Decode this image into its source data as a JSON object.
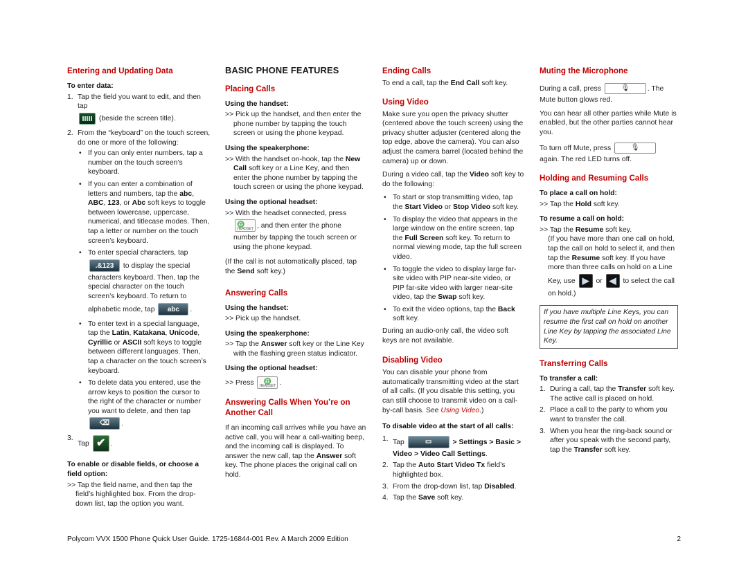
{
  "page_title": "BASIC PHONE FEATURES",
  "icons": {
    "keyboard": "keyboard-icon",
    "special_chars_label": ".&123",
    "abc_label": "abc",
    "delete_glyph": "⌫",
    "ok_glyph": "✔",
    "menu_glyph": "▭",
    "headset_glyph": "♎",
    "headset_label": "HEADSET",
    "mute_glyph": "🎙",
    "next_glyph": "▶",
    "prev_glyph": "◀"
  },
  "col1": {
    "heading": "Entering and Updating Data",
    "sub1": "To enter data:",
    "step1_a": "Tap the field you want to edit, and then tap",
    "step1_b": "(beside the screen title).",
    "step2": "From the “keyboard” on the touch screen, do one or more of the following:",
    "b1": "If you can only enter numbers, tap a number on the touch screen’s keyboard.",
    "b2_a": "If you can enter a combination of letters and numbers, tap the",
    "b2_abc": "abc",
    "b2_ABC": "ABC",
    "b2_123": "123",
    "b2_or": "or",
    "b2_Abc": "Abc",
    "b2_b": "soft keys to toggle between lowercase, uppercase, numerical, and titlecase modes. Then, tap a letter or number on the touch screen’s keyboard.",
    "b3_a": "To enter special characters, tap",
    "b3_b": "to display the special characters keyboard. Then, tap the special character on the touch screen’s keyboard. To return to alphabetic mode, tap",
    "b4_a": "To enter text in a special language, tap the",
    "b4_latin": "Latin",
    "b4_kata": "Katakana",
    "b4_uni": "Unicode",
    "b4_cyr": "Cyrillic",
    "b4_or": "or",
    "b4_ascii": "ASCII",
    "b4_b": "soft keys to toggle between different languages. Then, tap a character on the touch screen’s keyboard.",
    "b5": "To delete data you entered, use the arrow keys to position the cursor to the right of the character or number you want to delete, and then tap",
    "step3": "Tap",
    "sub2": "To enable or disable fields, or choose a field option:",
    "arrow": ">>",
    "p2": "Tap the field name, and then tap the field’s highlighted box. From the drop-down list, tap the option you want."
  },
  "col2": {
    "placing_heading": "Placing Calls",
    "handset_sub": "Using the handset:",
    "handset_text": "Pick up the handset, and then enter the phone number by tapping the touch screen or using the phone keypad.",
    "speaker_sub": "Using the speakerphone:",
    "speaker_a": "With the handset on-hook, tap the",
    "speaker_bold": "New Call",
    "speaker_b": "soft key or a Line Key, and then enter the phone number by tapping the touch screen or using the phone keypad.",
    "headset_sub": "Using the optional headset:",
    "headset_a": "With the headset connected, press",
    "headset_b": ", and then enter the phone number by tapping the touch screen or using the phone keypad.",
    "note_a": "(If the call is not automatically placed, tap the",
    "note_bold": "Send",
    "note_b": "soft key.)",
    "answering_heading": "Answering Calls",
    "ans_handset_sub": "Using the handset:",
    "ans_handset_text": "Pick up the handset.",
    "ans_speaker_sub": "Using the speakerphone:",
    "ans_speaker_a": "Tap the",
    "ans_speaker_bold": "Answer",
    "ans_speaker_b": "soft key or the Line Key with the flashing green status indicator.",
    "ans_headset_sub": "Using the optional headset:",
    "ans_headset_text": "Press",
    "another_heading": "Answering Calls When You’re on Another Call",
    "another_a": "If an incoming call arrives while you have an active call, you will hear a call-waiting beep, and the incoming call is displayed. To answer the new call, tap the",
    "another_bold": "Answer",
    "another_b": "soft key. The phone places the original call on hold.",
    "arrow": ">>"
  },
  "col3": {
    "ending_heading": "Ending Calls",
    "ending_a": "To end a call, tap the",
    "ending_bold": "End Call",
    "ending_b": "soft key.",
    "video_heading": "Using Video",
    "video_p1": "Make sure you open the privacy shutter (centered above the touch screen) using the privacy shutter adjuster (centered along the top edge, above the camera). You can also adjust the camera barrel (located behind the camera) up or down.",
    "video_p2_a": "During a video call, tap the",
    "video_p2_bold": "Video",
    "video_p2_b": "soft key to do the following:",
    "vb1_a": "To start or stop transmitting video, tap the",
    "vb1_start": "Start Video",
    "vb1_or": "or",
    "vb1_stop": "Stop Video",
    "vb1_b": "soft key.",
    "vb2_a": "To display the video that appears in the large window on the entire screen, tap the",
    "vb2_bold": "Full Screen",
    "vb2_b": "soft key. To return to normal viewing mode, tap the full screen video.",
    "vb3_a": "To toggle the video to display large far-site video with PIP near-site video, or PIP far-site video with larger near-site video, tap the",
    "vb3_bold": "Swap",
    "vb3_b": "soft key.",
    "vb4_a": "To exit the video options, tap the",
    "vb4_bold": "Back",
    "vb4_b": "soft key.",
    "video_p3": "During an audio-only call, the video soft keys are not available.",
    "disabling_heading": "Disabling Video",
    "dis_p1_a": "You can disable your phone from automatically transmitting video at the start of all calls. (If you disable this setting, you can still choose to transmit video on a call-by-call basis. See",
    "dis_link": "Using Video",
    "dis_p1_b": ".)",
    "dis_sub": "To disable video at the start of all calls:",
    "s1_a": "Tap",
    "s1_path": "> Settings > Basic > Video > Video Call Settings",
    "s2_a": "Tap the",
    "s2_bold": "Auto Start Video Tx",
    "s2_b": "field’s highlighted box.",
    "s3_a": "From the drop-down list, tap",
    "s3_bold": "Disabled",
    "s4_a": "Tap the",
    "s4_bold": "Save",
    "s4_b": "soft key."
  },
  "col4": {
    "mute_heading": "Muting the Microphone",
    "mute_p1_a": "During a call, press",
    "mute_p1_b": ". The Mute button glows red.",
    "mute_p2": "You can hear all other parties while Mute is enabled, but the other parties cannot hear you.",
    "mute_p3_a": "To turn off Mute, press",
    "mute_p3_b": "again. The red LED turns off.",
    "hold_heading": "Holding and Resuming Calls",
    "hold_sub1": "To place a call on hold:",
    "hold_a": "Tap the",
    "hold_bold": "Hold",
    "hold_b": "soft key.",
    "hold_sub2": "To resume a call on hold:",
    "resume_a": "Tap the",
    "resume_bold": "Resume",
    "resume_b": "soft key.",
    "resume_p_a": "(If you have more than one call on hold, tap the call on hold to select it, and then tap the",
    "resume_p_bold": "Resume",
    "resume_p_b": "soft key. If you have more than three calls on hold on a Line Key, use",
    "resume_or": "or",
    "resume_p_c": "to select the call on hold.)",
    "note": "If you have multiple Line Keys, you can resume the first call on hold on another Line Key by tapping the associated Line Key.",
    "transfer_heading": "Transferring Calls",
    "transfer_sub": "To transfer a call:",
    "t1_a": "During a call, tap the",
    "t1_bold": "Transfer",
    "t1_b": "soft key. The active call is placed on hold.",
    "t2": "Place a call to the party to whom you want to transfer the call.",
    "t3_a": "When you hear the ring-back sound or after you speak with the second party, tap the",
    "t3_bold": "Transfer",
    "t3_b": "soft key.",
    "arrow": ">>"
  },
  "footer": {
    "text": "Polycom VVX 1500 Phone Quick User Guide. 1725-16844-001 Rev. A  March 2009 Edition",
    "page_number": "2"
  }
}
